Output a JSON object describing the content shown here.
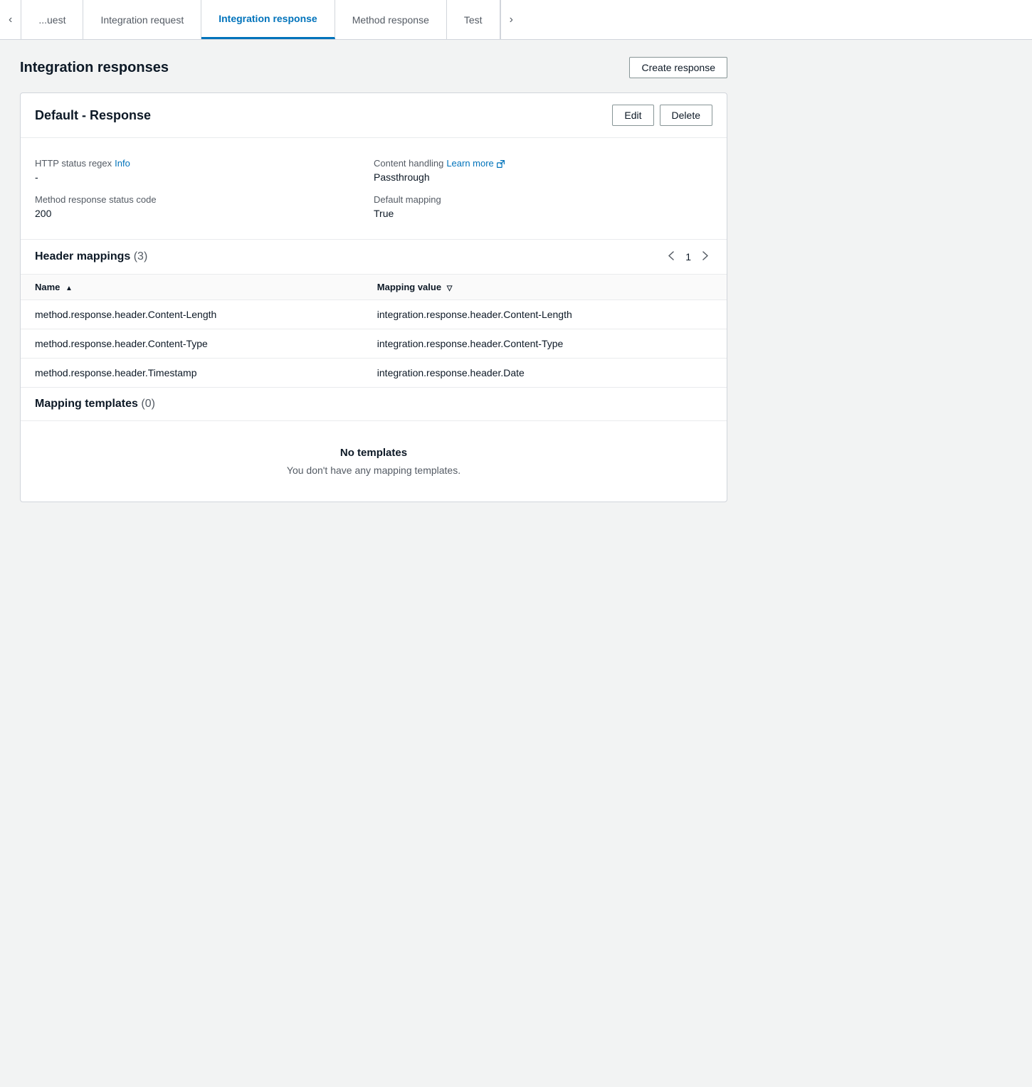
{
  "tabs": {
    "prev_arrow": "‹",
    "next_arrow": "›",
    "items": [
      {
        "id": "method-request",
        "label": "...uest",
        "active": false
      },
      {
        "id": "integration-request",
        "label": "Integration request",
        "active": false
      },
      {
        "id": "integration-response",
        "label": "Integration response",
        "active": true
      },
      {
        "id": "method-response",
        "label": "Method response",
        "active": false
      },
      {
        "id": "test",
        "label": "Test",
        "active": false
      }
    ]
  },
  "page": {
    "title": "Integration responses",
    "create_button": "Create response"
  },
  "card": {
    "title": "Default - Response",
    "edit_button": "Edit",
    "delete_button": "Delete"
  },
  "info": {
    "http_status_regex_label": "HTTP status regex",
    "http_status_regex_info": "Info",
    "http_status_regex_value": "-",
    "content_handling_label": "Content handling",
    "content_handling_learn_more": "Learn more",
    "content_handling_value": "Passthrough",
    "method_response_status_code_label": "Method response status code",
    "method_response_status_code_value": "200",
    "default_mapping_label": "Default mapping",
    "default_mapping_value": "True"
  },
  "header_mappings": {
    "title": "Header mappings",
    "count": "(3)",
    "pagination": {
      "page": "1"
    },
    "columns": [
      {
        "id": "name",
        "label": "Name",
        "sortable": true,
        "sort_dir": "asc"
      },
      {
        "id": "mapping_value",
        "label": "Mapping value",
        "sortable": true,
        "sort_dir": "desc"
      }
    ],
    "rows": [
      {
        "name": "method.response.header.Content-Length",
        "mapping_value": "integration.response.header.Content-Length"
      },
      {
        "name": "method.response.header.Content-Type",
        "mapping_value": "integration.response.header.Content-Type"
      },
      {
        "name": "method.response.header.Timestamp",
        "mapping_value": "integration.response.header.Date"
      }
    ]
  },
  "mapping_templates": {
    "title": "Mapping templates",
    "count": "(0)",
    "empty_title": "No templates",
    "empty_desc": "You don't have any mapping templates."
  }
}
